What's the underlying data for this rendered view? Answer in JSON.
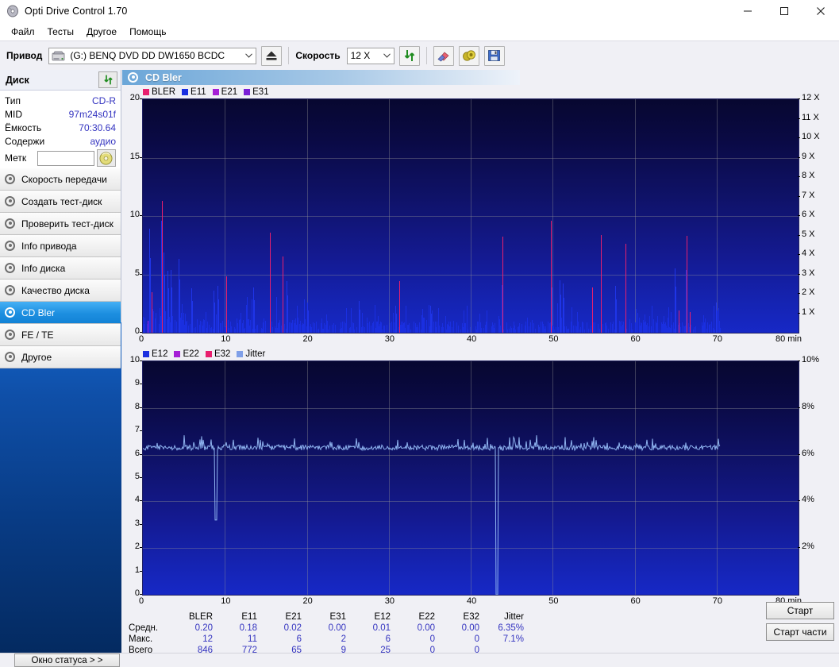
{
  "window": {
    "title": "Opti Drive Control 1.70",
    "app_icon": "cd-disc-icon",
    "minimize": "–",
    "maximize": "□",
    "close": "✕"
  },
  "menu": {
    "items": [
      "Файл",
      "Тесты",
      "Другое",
      "Помощь"
    ]
  },
  "toolbar": {
    "drive_label": "Привод",
    "drive_value": "(G:)  BENQ DVD DD DW1650 BCDC",
    "eject_title": "eject-icon",
    "speed_label": "Скорость",
    "speed_value": "12 X",
    "refresh_icon": "refresh-arrows-icon",
    "erase_icon": "eraser-icon",
    "coin_icon": "coins-icon",
    "save_icon": "floppy-save-icon"
  },
  "sidebar": {
    "disc_header": "Диск",
    "disc_refresh_icon": "refresh-arrows-icon",
    "disc_info": [
      {
        "key": "Тип",
        "value": "CD-R"
      },
      {
        "key": "MID",
        "value": "97m24s01f"
      },
      {
        "key": "Ёмкость",
        "value": "70:30.64"
      },
      {
        "key": "Содержи",
        "value": "аудио"
      }
    ],
    "label_key": "Метк",
    "label_value": "",
    "label_placeholder": "",
    "label_button_icon": "cd-disc-icon",
    "nav_items": [
      {
        "label": "Скорость передачи",
        "active": false
      },
      {
        "label": "Создать тест-диск",
        "active": false
      },
      {
        "label": "Проверить тест-диск",
        "active": false
      },
      {
        "label": "Info привода",
        "active": false
      },
      {
        "label": "Info диска",
        "active": false
      },
      {
        "label": "Качество диска",
        "active": false
      },
      {
        "label": "CD Bler",
        "active": true
      },
      {
        "label": "FE / TE",
        "active": false
      },
      {
        "label": "Другое",
        "active": false
      }
    ]
  },
  "panel": {
    "title": "CD Bler",
    "icon": "cd-disc-icon"
  },
  "buttons": {
    "start": "Старт",
    "start_part": "Старт части"
  },
  "statusbar": {
    "status_window": "Окно статуса > >"
  },
  "stats": {
    "columns": [
      "BLER",
      "E11",
      "E21",
      "E31",
      "E12",
      "E22",
      "E32",
      "Jitter"
    ],
    "rows": [
      {
        "label": "Средн.",
        "values": [
          "0.20",
          "0.18",
          "0.02",
          "0.00",
          "0.01",
          "0.00",
          "0.00",
          "6.35%"
        ]
      },
      {
        "label": "Макс.",
        "values": [
          "12",
          "11",
          "6",
          "2",
          "6",
          "0",
          "0",
          "7.1%"
        ]
      },
      {
        "label": "Всего",
        "values": [
          "846",
          "772",
          "65",
          "9",
          "25",
          "0",
          "0",
          ""
        ]
      }
    ]
  },
  "chart_data": [
    {
      "type": "bar",
      "name": "cd-bler-errors",
      "title": "CD Bler",
      "xlabel": "min",
      "ylabel": "",
      "xlim": [
        0,
        80
      ],
      "ylim": [
        0,
        20
      ],
      "xticks": [
        0,
        10,
        20,
        30,
        40,
        50,
        60,
        70,
        80
      ],
      "xtick_labels": [
        "0",
        "10",
        "20",
        "30",
        "40",
        "50",
        "60",
        "70",
        "80 min"
      ],
      "yticks": [
        0,
        5,
        10,
        15,
        20
      ],
      "ytick_labels": [
        "0",
        "5",
        "10",
        "15",
        "20"
      ],
      "y2lim": [
        0,
        12
      ],
      "y2ticks": [
        1,
        2,
        3,
        4,
        5,
        6,
        7,
        8,
        9,
        10,
        11,
        12
      ],
      "y2tick_labels": [
        "1 X",
        "2 X",
        "3 X",
        "4 X",
        "5 X",
        "6 X",
        "7 X",
        "8 X",
        "9 X",
        "10 X",
        "11 X",
        "12 X"
      ],
      "grid": true,
      "legend_position": "top-left",
      "legend": [
        {
          "name": "BLER",
          "color": "#e81f6e"
        },
        {
          "name": "E11",
          "color": "#1a2fe0"
        },
        {
          "name": "E21",
          "color": "#a51fd6"
        },
        {
          "name": "E31",
          "color": "#7a1fd6"
        }
      ],
      "data_end_min": 70.5,
      "series": [
        {
          "name": "BLER",
          "color": "#e81f6e",
          "points": [
            [
              1.1,
              3.5
            ],
            [
              2.3,
              11.3
            ],
            [
              10.2,
              4.8
            ],
            [
              15.5,
              8.6
            ],
            [
              17.0,
              6.5
            ],
            [
              31.3,
              4.4
            ],
            [
              43.9,
              8.2
            ],
            [
              49.8,
              9.6
            ],
            [
              54.8,
              3.9
            ],
            [
              55.9,
              8.4
            ],
            [
              58.9,
              7.6
            ],
            [
              65.4,
              1.9
            ],
            [
              66.3,
              8.3
            ],
            [
              66.7,
              1.8
            ]
          ]
        },
        {
          "name": "E11",
          "color": "#1a2fe0",
          "baseline": 1.0,
          "spikes": [
            [
              0.8,
              8.9
            ],
            [
              2.2,
              9.6
            ],
            [
              2.5,
              6.9
            ],
            [
              3.0,
              5.3
            ],
            [
              3.4,
              5.4
            ],
            [
              4.4,
              6.3
            ],
            [
              5.9,
              3.8
            ],
            [
              8.6,
              3.6
            ],
            [
              9.1,
              4.0
            ],
            [
              13.5,
              3.9
            ],
            [
              17.5,
              4.4
            ],
            [
              20.0,
              2.6
            ],
            [
              26.3,
              2.7
            ],
            [
              30.8,
              2.3
            ],
            [
              35.1,
              2.3
            ],
            [
              43.8,
              4.1
            ],
            [
              49.8,
              5.4
            ],
            [
              50.8,
              4.5
            ],
            [
              51.2,
              4.2
            ],
            [
              57.6,
              4.0
            ],
            [
              64.9,
              5.5
            ],
            [
              66.2,
              5.4
            ],
            [
              69.9,
              2.6
            ]
          ]
        },
        {
          "name": "E21",
          "color": "#a51fd6",
          "points": [
            [
              0.6,
              1.0
            ],
            [
              58.9,
              2.1
            ],
            [
              65.4,
              1.9
            ]
          ]
        },
        {
          "name": "E31",
          "color": "#7a1fd6",
          "points": [
            [
              17.0,
              0.6
            ],
            [
              54.8,
              0.5
            ]
          ]
        }
      ]
    },
    {
      "type": "line",
      "name": "cd-bler-jitter",
      "title": "",
      "xlabel": "min",
      "ylabel": "",
      "xlim": [
        0,
        80
      ],
      "ylim": [
        0,
        10
      ],
      "xticks": [
        0,
        10,
        20,
        30,
        40,
        50,
        60,
        70,
        80
      ],
      "xtick_labels": [
        "0",
        "10",
        "20",
        "30",
        "40",
        "50",
        "60",
        "70",
        "80 min"
      ],
      "yticks": [
        0,
        1,
        2,
        3,
        4,
        5,
        6,
        7,
        8,
        9,
        10
      ],
      "ytick_labels": [
        "0",
        "1",
        "2",
        "3",
        "4",
        "5",
        "6",
        "7",
        "8",
        "9",
        "10"
      ],
      "y2lim": [
        0,
        10
      ],
      "y2ticks": [
        2,
        4,
        6,
        8,
        10
      ],
      "y2tick_labels": [
        "2%",
        "4%",
        "6%",
        "8%",
        "10%"
      ],
      "grid": true,
      "legend_position": "top-left",
      "legend": [
        {
          "name": "E12",
          "color": "#1a2fe0"
        },
        {
          "name": "E22",
          "color": "#a51fd6"
        },
        {
          "name": "E32",
          "color": "#e81f6e"
        },
        {
          "name": "Jitter",
          "color": "#7f9fe8"
        }
      ],
      "data_end_min": 70.5,
      "series": [
        {
          "name": "Jitter",
          "color": "#8fb4f0",
          "mean": 6.35,
          "max": 7.1,
          "min": 6.2,
          "dropouts": [
            [
              8.9,
              3.2
            ],
            [
              43.2,
              0.0
            ]
          ]
        }
      ]
    }
  ]
}
